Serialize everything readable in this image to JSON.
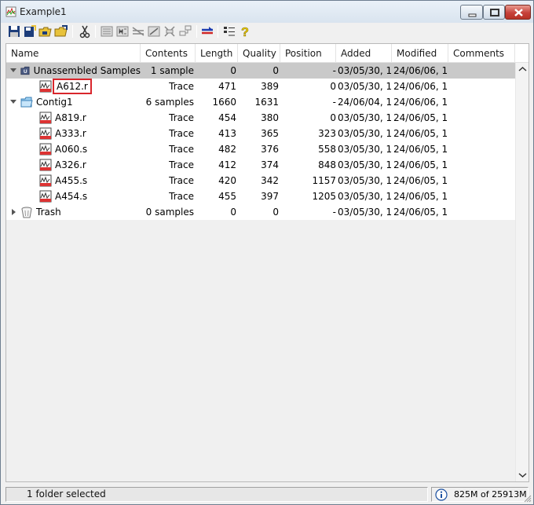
{
  "window": {
    "title": "Example1"
  },
  "columns": [
    {
      "label": "Name"
    },
    {
      "label": "Contents"
    },
    {
      "label": "Length"
    },
    {
      "label": "Quality"
    },
    {
      "label": "Position"
    },
    {
      "label": "Added"
    },
    {
      "label": "Modified"
    },
    {
      "label": "Comments"
    }
  ],
  "rows": [
    {
      "name": "Unassembled Samples",
      "contents": "1 sample",
      "length": "0",
      "quality": "0",
      "position": "-",
      "added": "03/05/30, 1...",
      "modified": "24/06/06, 1...",
      "comments": ""
    },
    {
      "name": "A612.r",
      "contents": "Trace",
      "length": "471",
      "quality": "389",
      "position": "0",
      "added": "03/05/30, 1...",
      "modified": "24/06/06, 1...",
      "comments": ""
    },
    {
      "name": "Contig1",
      "contents": "6 samples",
      "length": "1660",
      "quality": "1631",
      "position": "-",
      "added": "24/06/04, 1...",
      "modified": "24/06/06, 1...",
      "comments": ""
    },
    {
      "name": "A819.r",
      "contents": "Trace",
      "length": "454",
      "quality": "380",
      "position": "0",
      "added": "03/05/30, 1...",
      "modified": "24/06/05, 1...",
      "comments": ""
    },
    {
      "name": "A333.r",
      "contents": "Trace",
      "length": "413",
      "quality": "365",
      "position": "323",
      "added": "03/05/30, 1...",
      "modified": "24/06/05, 1...",
      "comments": ""
    },
    {
      "name": "A060.s",
      "contents": "Trace",
      "length": "482",
      "quality": "376",
      "position": "558",
      "added": "03/05/30, 1...",
      "modified": "24/06/05, 1...",
      "comments": ""
    },
    {
      "name": "A326.r",
      "contents": "Trace",
      "length": "412",
      "quality": "374",
      "position": "848",
      "added": "03/05/30, 1...",
      "modified": "24/06/05, 1...",
      "comments": ""
    },
    {
      "name": "A455.s",
      "contents": "Trace",
      "length": "420",
      "quality": "342",
      "position": "1157",
      "added": "03/05/30, 1...",
      "modified": "24/06/05, 1...",
      "comments": ""
    },
    {
      "name": "A454.s",
      "contents": "Trace",
      "length": "455",
      "quality": "397",
      "position": "1205",
      "added": "03/05/30, 1...",
      "modified": "24/06/05, 1...",
      "comments": ""
    },
    {
      "name": "Trash",
      "contents": "0 samples",
      "length": "0",
      "quality": "0",
      "position": "-",
      "added": "03/05/30, 1...",
      "modified": "24/06/05, 1...",
      "comments": ""
    }
  ],
  "status": {
    "message": "1 folder selected",
    "memory": "825M of 25913M"
  },
  "colors": {
    "selected_row": "#c9c9c9",
    "highlight_box": "#d9262c",
    "close_button": "#c6413a"
  }
}
